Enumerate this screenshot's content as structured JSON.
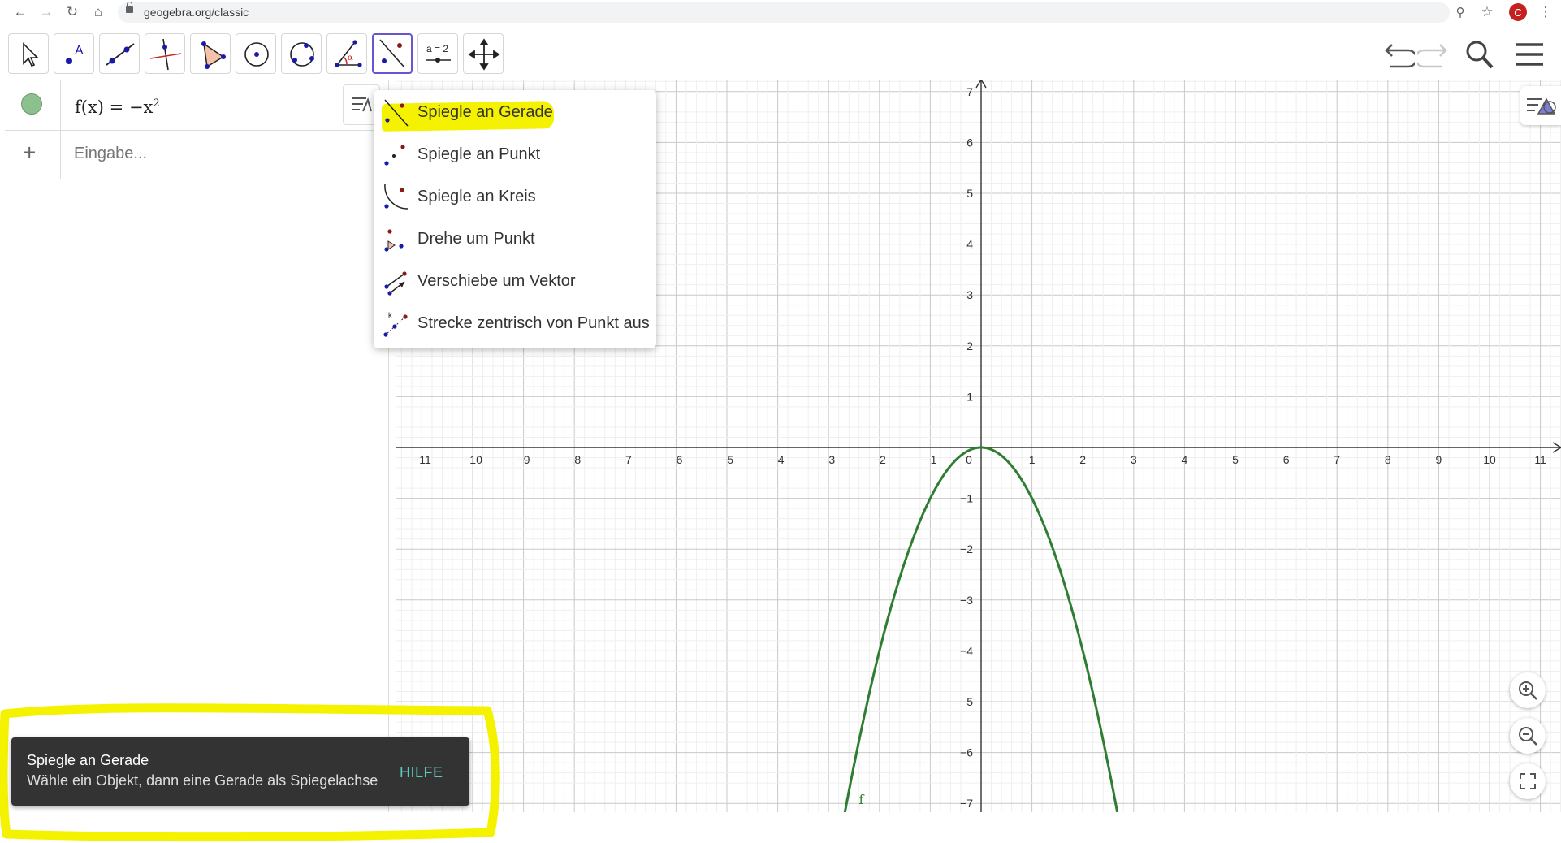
{
  "browser": {
    "url": "geogebra.org/classic",
    "avatar_letter": "C"
  },
  "toolbar": {
    "tools": [
      "move-tool",
      "point-tool",
      "line-tool",
      "perpendicular-line-tool",
      "polygon-tool",
      "circle-tool",
      "conic-tool",
      "angle-tool",
      "reflect-tool",
      "slider-tool",
      "move-graphics-tool"
    ],
    "slider_label": "a = 2",
    "active_tool": "reflect-tool"
  },
  "algebra": {
    "function_name": "f(x) = ",
    "function_expr": "−x",
    "function_exp": "2",
    "input_placeholder": "Eingabe..."
  },
  "menu": {
    "items": [
      {
        "label": "Spiegle an Gerade",
        "icon": "reflect-line-icon"
      },
      {
        "label": "Spiegle an Punkt",
        "icon": "reflect-point-icon"
      },
      {
        "label": "Spiegle an Kreis",
        "icon": "reflect-circle-icon"
      },
      {
        "label": "Drehe um Punkt",
        "icon": "rotate-point-icon"
      },
      {
        "label": "Verschiebe um Vektor",
        "icon": "translate-vector-icon"
      },
      {
        "label": "Strecke zentrisch von Punkt aus",
        "icon": "dilate-point-icon"
      }
    ]
  },
  "graph": {
    "x_ticks": [
      "−11",
      "−10",
      "−9",
      "−8",
      "−7",
      "−6",
      "−5",
      "−4",
      "−3",
      "−2",
      "−1",
      "0",
      "1",
      "2",
      "3",
      "4",
      "5",
      "6",
      "7",
      "8",
      "9",
      "10",
      "11"
    ],
    "y_ticks": [
      "7",
      "6",
      "5",
      "4",
      "3",
      "2",
      "1",
      "−1",
      "−2",
      "−3",
      "−4",
      "−5",
      "−6",
      "−7"
    ],
    "curve_label": "f",
    "curve_color": "#2e7d32",
    "function": "f(x) = -x^2"
  },
  "toast": {
    "title": "Spiegle an Gerade",
    "message": "Wähle ein Objekt, dann eine Gerade als Spiegelachse",
    "help": "HILFE"
  },
  "colors": {
    "highlight": "#f5f200",
    "active_tool_border": "#6557d2",
    "toast_bg": "#333333",
    "help_color": "#5cc8c0"
  }
}
